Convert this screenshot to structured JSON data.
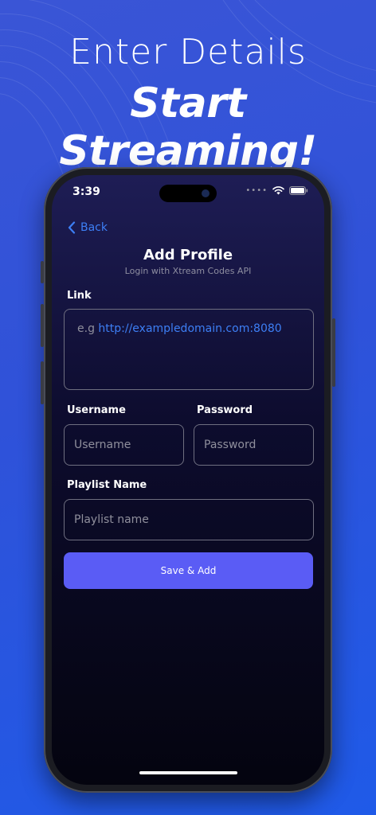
{
  "hero": {
    "line1": "Enter Details",
    "line2": "Start Streaming!"
  },
  "status_bar": {
    "time": "3:39",
    "icons": [
      "signal-dots-icon",
      "wifi-icon",
      "battery-icon"
    ]
  },
  "nav": {
    "back_label": "Back"
  },
  "header": {
    "title": "Add Profile",
    "subtitle": "Login with Xtream Codes API"
  },
  "form": {
    "link": {
      "label": "Link",
      "placeholder_prefix": "e.g ",
      "placeholder_url": "http://exampledomain.com:8080"
    },
    "username": {
      "label": "Username",
      "placeholder": "Username"
    },
    "password": {
      "label": "Password",
      "placeholder": "Password"
    },
    "playlist": {
      "label": "Playlist Name",
      "placeholder": "Playlist name"
    },
    "submit_label": "Save & Add"
  },
  "colors": {
    "accent_blue": "#3d7ff5",
    "button": "#5a5cf5",
    "background": "#2f52d9"
  }
}
